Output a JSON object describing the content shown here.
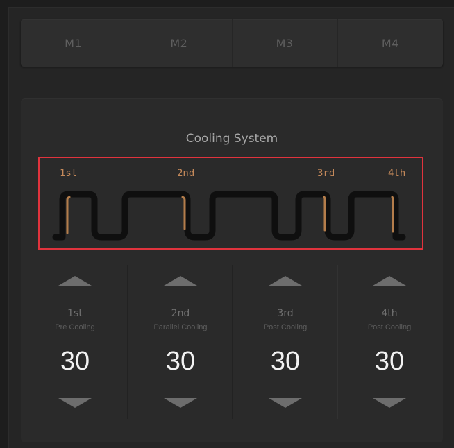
{
  "modes": [
    "M1",
    "M2",
    "M3",
    "M4"
  ],
  "panel": {
    "title": "Cooling System"
  },
  "diagram": {
    "stage_labels": [
      "1st",
      "2nd",
      "3rd",
      "4th"
    ],
    "colors": {
      "pipe": "#0f0f0f",
      "active_segment": "#b47d4b",
      "highlight_border": "#e0333d"
    }
  },
  "controls": [
    {
      "stage": "1st",
      "type": "Pre Cooling",
      "value": "30",
      "up_icon": "triangle-up-icon",
      "down_icon": "triangle-down-icon"
    },
    {
      "stage": "2nd",
      "type": "Parallel Cooling",
      "value": "30",
      "up_icon": "triangle-up-icon",
      "down_icon": "triangle-down-icon"
    },
    {
      "stage": "3rd",
      "type": "Post Cooling",
      "value": "30",
      "up_icon": "triangle-up-icon",
      "down_icon": "triangle-down-icon"
    },
    {
      "stage": "4th",
      "type": "Post Cooling",
      "value": "30",
      "up_icon": "triangle-up-icon",
      "down_icon": "triangle-down-icon"
    }
  ]
}
